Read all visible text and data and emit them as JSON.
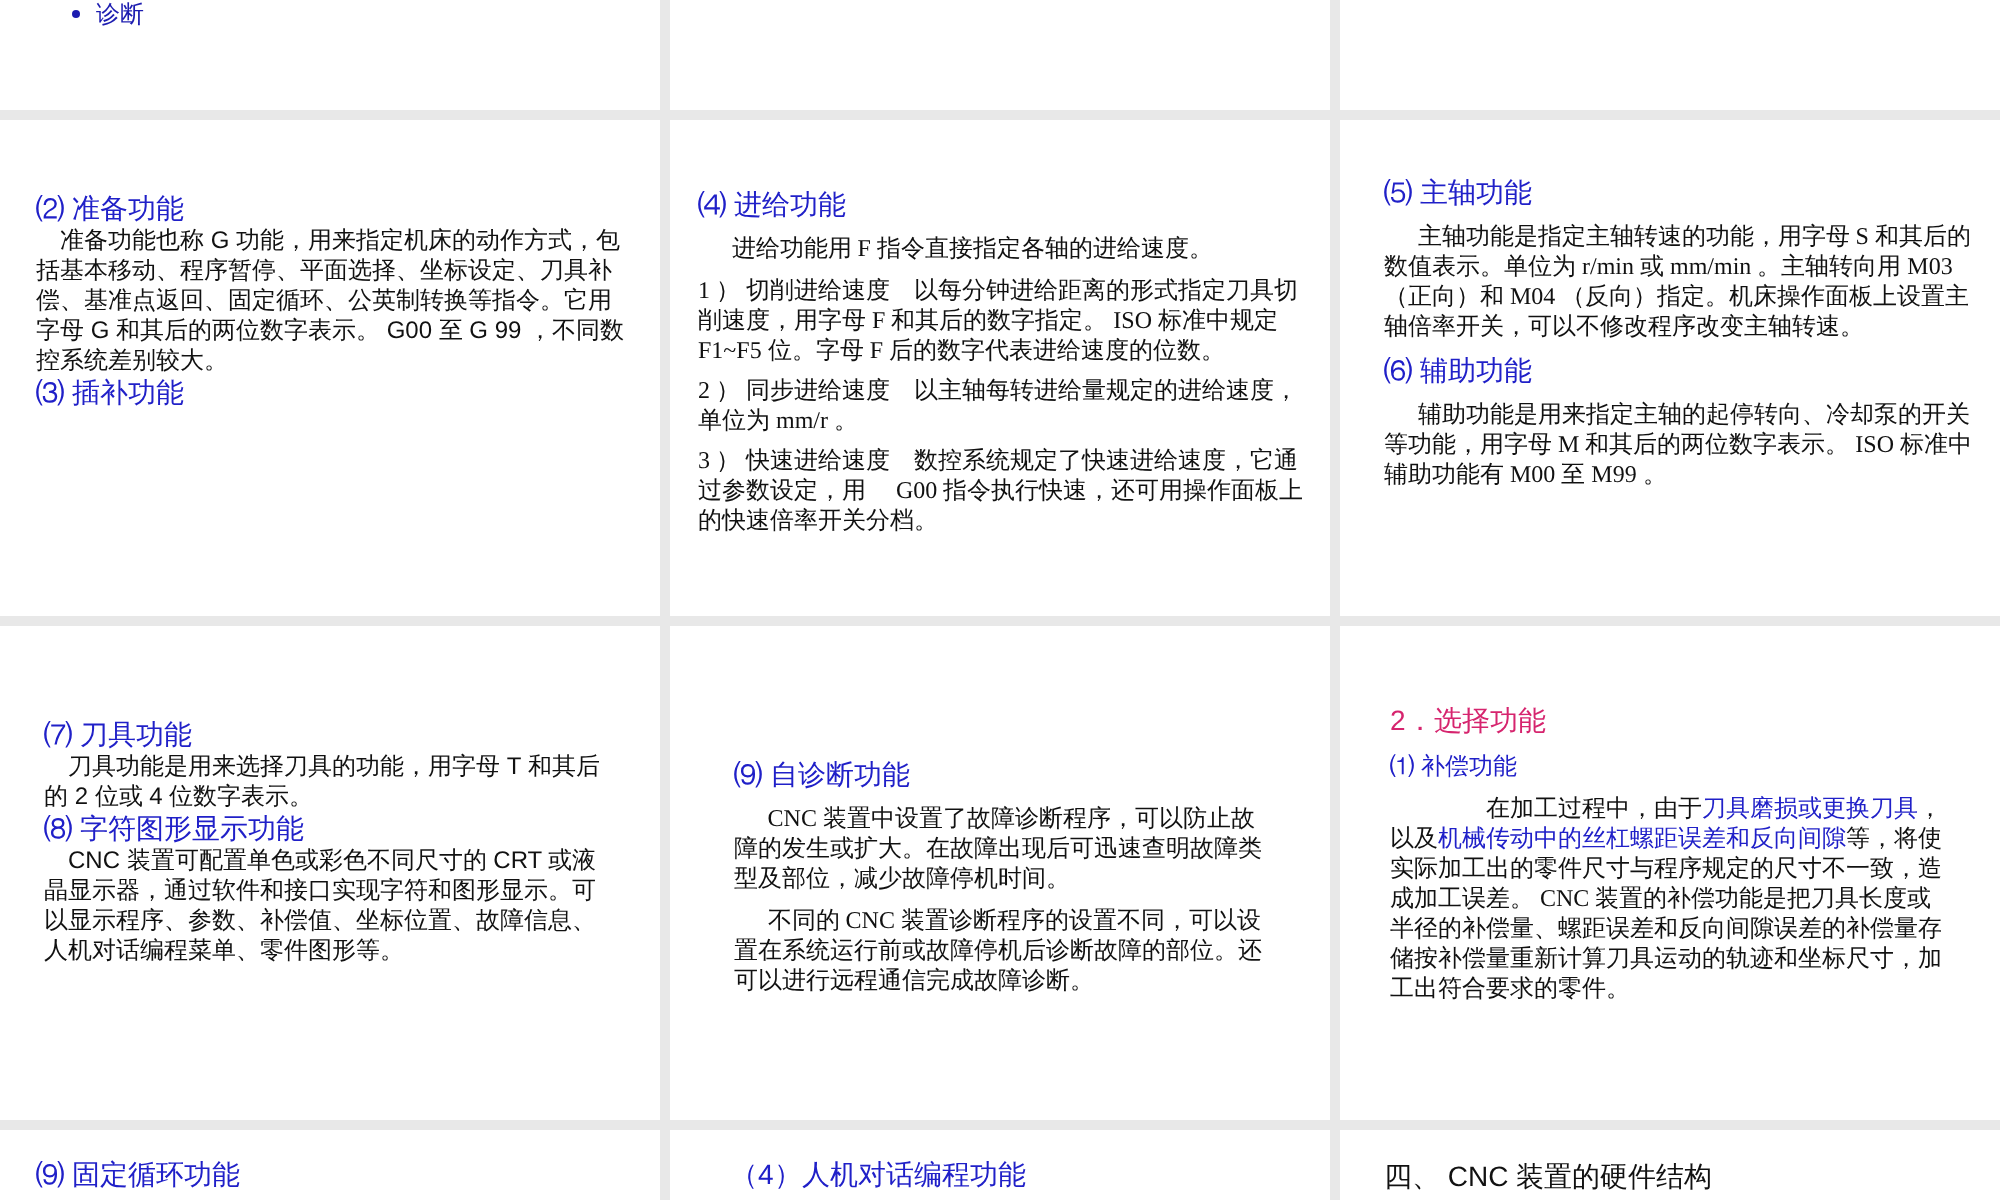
{
  "slides": [
    {
      "blocks": [
        {
          "kind": "bullet",
          "text": "诊断"
        }
      ]
    },
    {
      "blocks": [
        {
          "kind": "heading",
          "text": "⑵ 准备功能"
        },
        {
          "kind": "paragraph",
          "text": "准备功能也称 G 功能，用来指定机床的动作方式，包括基本移动、程序暂停、平面选择、坐标设定、刀具补偿、基准点返回、固定循环、公英制转换等指令。它用字母 G 和其后的两位数字表示。 G00 至 G 99 ，不同数控系统差别较大。"
        },
        {
          "kind": "heading",
          "text": "⑶ 插补功能"
        }
      ]
    },
    {
      "blocks": [
        {
          "kind": "heading",
          "text": "⑷ 进给功能"
        },
        {
          "kind": "paragraph",
          "text": "进给功能用 F 指令直接指定各轴的进给速度。"
        },
        {
          "kind": "item",
          "text": "1 ） 切削进给速度　以每分钟进给距离的形式指定刀具切削速度，用字母 F 和其后的数字指定。 ISO 标准中规定 F1~F5 位。字母 F 后的数字代表进给速度的位数。"
        },
        {
          "kind": "item",
          "text": "2 ） 同步进给速度　以主轴每转进给量规定的进给速度，单位为 mm/r 。"
        },
        {
          "kind": "item",
          "text": "3 ） 快速进给速度　数控系统规定了快速进给速度，它通过参数设定，用　 G00 指令执行快速，还可用操作面板上的快速倍率开关分档。"
        }
      ]
    },
    {
      "blocks": [
        {
          "kind": "heading",
          "text": "⑸ 主轴功能"
        },
        {
          "kind": "paragraph",
          "text": "主轴功能是指定主轴转速的功能，用字母 S 和其后的数值表示。单位为 r/min 或 mm/min 。主轴转向用 M03 （正向）和 M04 （反向）指定。机床操作面板上设置主轴倍率开关，可以不修改程序改变主轴转速。"
        },
        {
          "kind": "heading",
          "text": "⑹ 辅助功能"
        },
        {
          "kind": "paragraph",
          "text": "辅助功能是用来指定主轴的起停转向、冷却泵的开关等功能，用字母 M 和其后的两位数字表示。 ISO 标准中辅助功能有 M00 至 M99 。"
        }
      ]
    },
    {
      "blocks": [
        {
          "kind": "heading",
          "text": "⑺ 刀具功能"
        },
        {
          "kind": "paragraph",
          "text": "刀具功能是用来选择刀具的功能，用字母 T 和其后的 2 位或 4 位数字表示。"
        },
        {
          "kind": "heading",
          "text": "⑻ 字符图形显示功能"
        },
        {
          "kind": "paragraph",
          "text": "CNC 装置可配置单色或彩色不同尺寸的 CRT 或液晶显示器，通过软件和接口实现字符和图形显示。可以显示程序、参数、补偿值、坐标位置、故障信息、人机对话编程菜单、零件图形等。"
        }
      ]
    },
    {
      "blocks": [
        {
          "kind": "heading",
          "text": "⑼ 自诊断功能"
        },
        {
          "kind": "paragraph",
          "text": "CNC 装置中设置了故障诊断程序，可以防止故障的发生或扩大。在故障出现后可迅速查明故障类型及部位，减少故障停机时间。"
        },
        {
          "kind": "paragraph",
          "text": "不同的 CNC 装置诊断程序的设置不同，可以设置在系统运行前或故障停机后诊断故障的部位。还可以进行远程通信完成故障诊断。"
        }
      ]
    },
    {
      "blocks": [
        {
          "kind": "section",
          "text": "2．选择功能"
        },
        {
          "kind": "subheading",
          "text": "⑴ 补偿功能"
        },
        {
          "kind": "mixed",
          "parts": [
            {
              "text": "在加工过程中，由于",
              "emphasis": false
            },
            {
              "text": "刀具磨损或更换刀具",
              "emphasis": true
            },
            {
              "text": "，以及",
              "emphasis": false
            },
            {
              "text": "机械传动中的丝杠螺距误差和反向间隙",
              "emphasis": true
            },
            {
              "text": "等，将使实际加工出的零件尺寸与程序规定的尺寸不一致，造成加工误差。 CNC 装置的补偿功能是把刀具长度或半径的补偿量、螺距误差和反向间隙误差的补偿量存储按补偿量重新计算刀具运动的轨迹和坐标尺寸，加工出符合要求的零件。",
              "emphasis": false
            }
          ]
        }
      ]
    },
    {
      "blocks": [
        {
          "kind": "heading",
          "text": "⑼ 固定循环功能"
        }
      ]
    },
    {
      "blocks": [
        {
          "kind": "heading",
          "text": "（4）人机对话编程功能"
        }
      ]
    },
    {
      "blocks": [
        {
          "kind": "title",
          "text": "四、 CNC 装置的硬件结构"
        }
      ]
    }
  ]
}
